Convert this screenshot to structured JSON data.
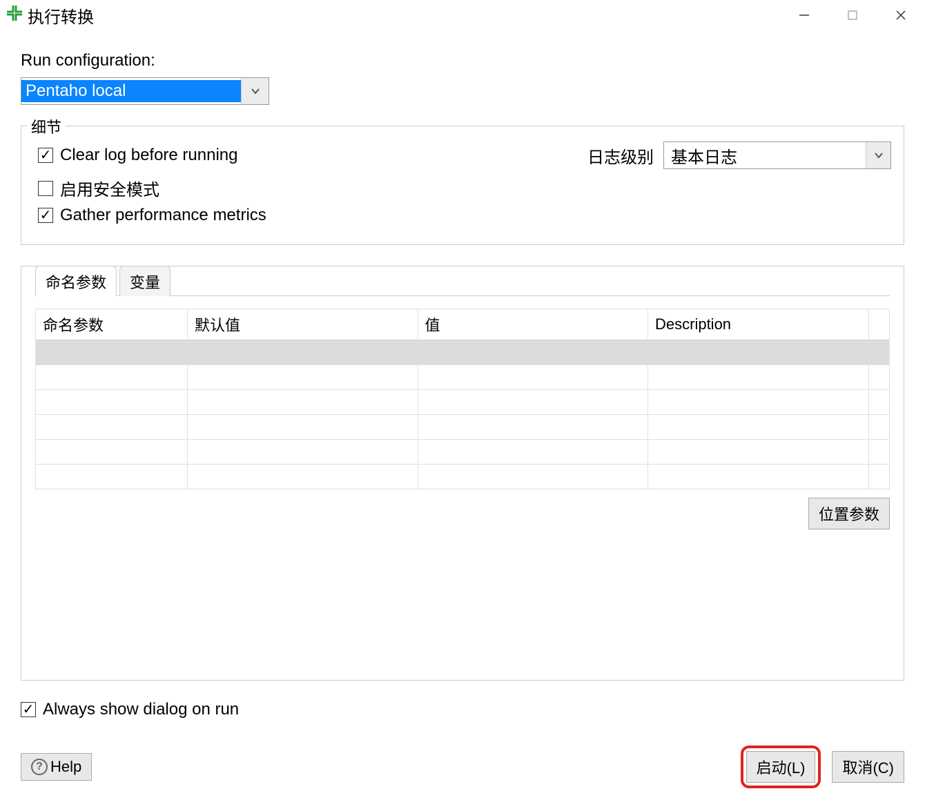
{
  "titlebar": {
    "title": "执行转换"
  },
  "runconfig": {
    "label": "Run configuration:",
    "value": "Pentaho local"
  },
  "details": {
    "legend": "细节",
    "clear_log": {
      "label": "Clear log before running",
      "checked": true
    },
    "safe_mode": {
      "label": "启用安全模式",
      "checked": false
    },
    "gather_metrics": {
      "label": "Gather performance metrics",
      "checked": true
    },
    "log_level_label": "日志级别",
    "log_level_value": "基本日志"
  },
  "tabs": {
    "named_params": "命名参数",
    "variables": "变量"
  },
  "table": {
    "headers": {
      "param": "命名参数",
      "default": "默认值",
      "value": "值",
      "description": "Description"
    }
  },
  "buttons": {
    "position_params": "位置参数",
    "help": "Help",
    "launch": "启动(L)",
    "cancel": "取消(C)"
  },
  "always_show": {
    "label": "Always show dialog on run",
    "checked": true
  }
}
